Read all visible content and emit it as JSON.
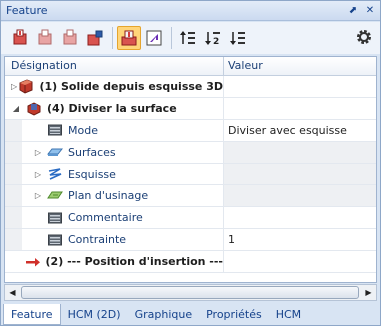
{
  "window": {
    "title": "Feature"
  },
  "titlebar": {
    "pin_glyph": "⬈",
    "close_glyph": "✕"
  },
  "toolbar": {
    "tools": [
      {
        "name": "insert-feature-icon",
        "active": false
      },
      {
        "name": "insert-below-icon",
        "active": false
      },
      {
        "name": "insert-above-icon",
        "active": false
      },
      {
        "name": "edit-feature-icon",
        "active": false
      },
      {
        "name": "feature-active-icon",
        "active": true
      },
      {
        "name": "open-sketch-icon",
        "active": false
      },
      {
        "name": "sort-up-icon",
        "active": false
      },
      {
        "name": "sort-12-icon",
        "active": false
      },
      {
        "name": "sort-down-icon",
        "active": false
      }
    ],
    "sort_12_label": "2"
  },
  "grid": {
    "col_designation": "Désignation",
    "col_value": "Valeur",
    "rows": [
      {
        "label": "(1) Solide depuis esquisse 3D",
        "value": "",
        "icon": "solid-icon",
        "expander": "collapsed",
        "level": 0,
        "bold": true
      },
      {
        "label": "(4) Diviser la surface",
        "value": "",
        "icon": "split-surface-icon",
        "expander": "expanded",
        "level": 0,
        "bold": true
      },
      {
        "label": "Mode",
        "value": "Diviser avec esquisse",
        "icon": "property-icon",
        "expander": "none",
        "level": 1,
        "bold": false
      },
      {
        "label": "Surfaces",
        "value": "",
        "icon": "surface-icon",
        "expander": "collapsed",
        "level": 1,
        "bold": false
      },
      {
        "label": "Esquisse",
        "value": "",
        "icon": "sketch-icon",
        "expander": "collapsed",
        "level": 1,
        "bold": false
      },
      {
        "label": "Plan d'usinage",
        "value": "",
        "icon": "plane-icon",
        "expander": "collapsed",
        "level": 1,
        "bold": false
      },
      {
        "label": "Commentaire",
        "value": "",
        "icon": "property-icon",
        "expander": "none",
        "level": 1,
        "bold": false
      },
      {
        "label": "Contrainte",
        "value": "1",
        "icon": "property-icon",
        "expander": "none",
        "level": 1,
        "bold": false
      },
      {
        "label": "(2) --- Position  d'insertion ---",
        "value": "",
        "icon": "insert-arrow-icon",
        "expander": "none",
        "level": 0,
        "bold": true
      }
    ]
  },
  "tabs": [
    {
      "label": "Feature",
      "active": true
    },
    {
      "label": "HCM (2D)",
      "active": false
    },
    {
      "label": "Graphique",
      "active": false
    },
    {
      "label": "Propriétés",
      "active": false
    },
    {
      "label": "HCM",
      "active": false
    }
  ],
  "colors": {
    "accent": "#15428b",
    "active_tool": "#ffd57a",
    "row_grey": "#eef0f3"
  }
}
